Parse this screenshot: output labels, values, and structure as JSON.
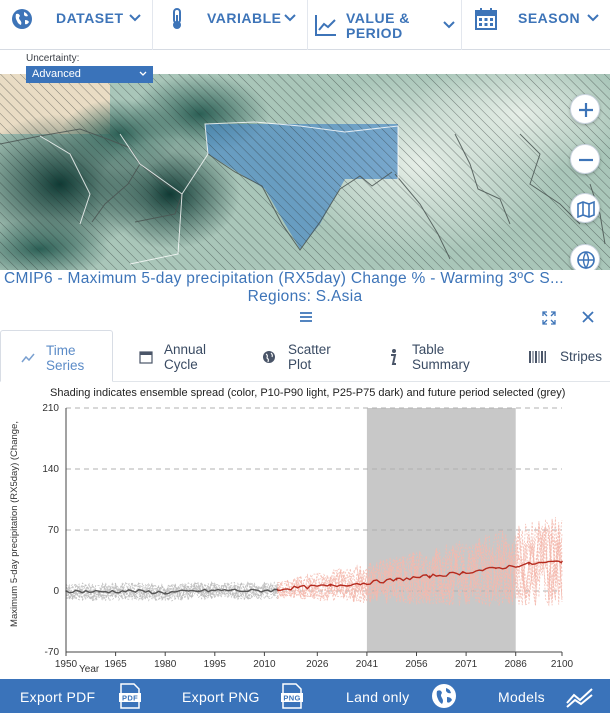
{
  "topbar": {
    "dataset": "DATASET",
    "variable": "VARIABLE",
    "value_period_line1": "VALUE &",
    "value_period_line2": "PERIOD",
    "season": "SEASON"
  },
  "uncertainty": {
    "label": "Uncertainty:",
    "value": "Advanced"
  },
  "map": {
    "title": "CMIP6 - Maximum 5-day precipitation (RX5day) Change % - Warming 3ºC S...",
    "regions": "Regions: S.Asia"
  },
  "tabs": [
    {
      "line1": "Time",
      "line2": "Series",
      "icon": "line-chart-icon"
    },
    {
      "line1": "Annual",
      "line2": "Cycle",
      "icon": "calendar-icon"
    },
    {
      "line1": "Scatter",
      "line2": "Plot",
      "icon": "globe-icon"
    },
    {
      "line1": "Table",
      "line2": "Summary",
      "icon": "info-icon"
    },
    {
      "line1": "Stripes",
      "line2": "",
      "icon": "stripes-icon"
    }
  ],
  "note": "Shading indicates ensemble spread (color, P10-P90 light, P25-P75 dark) and future period selected (grey)",
  "chart_data": {
    "type": "line",
    "ylabel": "Maximum 5-day precipitation (RX5day) (Change,",
    "xlabel": "Year",
    "yticks": [
      -70,
      0,
      70,
      140,
      210
    ],
    "ylim": [
      -70,
      210
    ],
    "xticks": [
      1950,
      1965,
      1980,
      1995,
      2010,
      2026,
      2041,
      2056,
      2071,
      2086,
      2100
    ],
    "xlim": [
      1950,
      2100
    ],
    "future_period": [
      2041,
      2086
    ],
    "colors": {
      "historical": "#555555",
      "future": "#b52a1e",
      "spread_hist": "#bdbdbd",
      "spread_future": "#f4b9ae",
      "period": "#c8c8c8"
    },
    "series": [
      {
        "x": [
          1950,
          1960,
          1970,
          1980,
          1990,
          2000,
          2005,
          2014
        ],
        "values": [
          0,
          -1,
          0,
          -2,
          0,
          1,
          0,
          1
        ]
      },
      {
        "x": [
          2014,
          2020,
          2030,
          2040,
          2050,
          2060,
          2070,
          2080,
          2090,
          2100
        ],
        "values": [
          2,
          4,
          6,
          9,
          13,
          17,
          21,
          26,
          31,
          34
        ]
      }
    ]
  },
  "footer": {
    "export_pdf": "Export PDF",
    "pdf_badge": "PDF",
    "export_png": "Export PNG",
    "png_badge": "PNG",
    "land_only": "Land only",
    "models": "Models"
  }
}
